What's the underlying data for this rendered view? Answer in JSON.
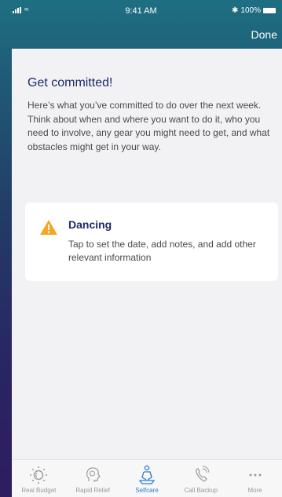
{
  "status_bar": {
    "time": "9:41 AM",
    "battery": "100%"
  },
  "nav": {
    "done_label": "Done"
  },
  "main": {
    "title": "Get committed!",
    "intro": "Here’s what you’ve committed to do over the next week. Think about when and where you want to do it, who you need to involve, any gear you might need to get, and what obstacles might get in your way.",
    "card": {
      "title": "Dancing",
      "description": "Tap to set the date, add notes, and add other relevant information",
      "icon": "warning-icon"
    }
  },
  "tab_bar": {
    "active_color": "#2f7bd6",
    "inactive_color": "#9a9a9a",
    "tabs": [
      {
        "label": "Real Budget",
        "icon": "sun-icon"
      },
      {
        "label": "Rapid Relief",
        "icon": "head-icon"
      },
      {
        "label": "Selfcare",
        "icon": "meditation-icon",
        "active": true
      },
      {
        "label": "Call Backup",
        "icon": "phone-icon"
      },
      {
        "label": "More",
        "icon": "more-icon"
      }
    ]
  },
  "colors": {
    "title": "#1b2b6b",
    "warning": "#f5a623"
  }
}
